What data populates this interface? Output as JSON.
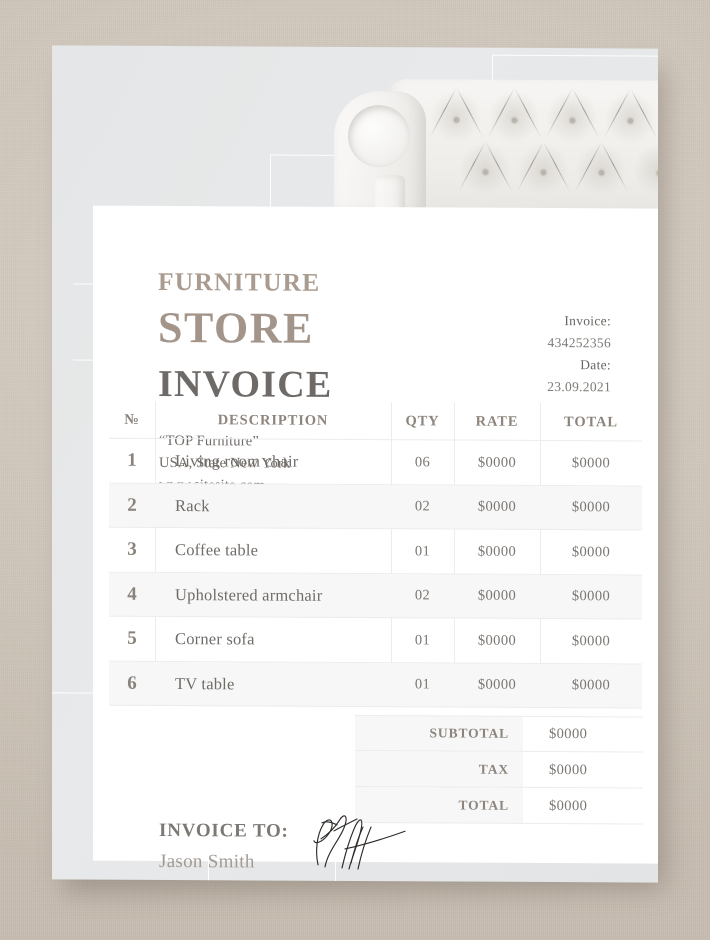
{
  "document": {
    "type": "invoice-template",
    "brand": {
      "line1": "FURNITURE",
      "line2": "STORE",
      "line3": "INVOICE"
    },
    "company": {
      "name": "“TOP Furniture”",
      "address": "USA, State New York",
      "website": "www.sitesite.com"
    },
    "meta": {
      "invoice_label": "Invoice:",
      "invoice_number": "434252356",
      "date_label": "Date:",
      "date_value": "23.09.2021"
    },
    "table": {
      "headers": {
        "no": "№",
        "description": "DESCRIPTION",
        "qty": "QTY",
        "rate": "RATE",
        "total": "TOTAL"
      },
      "rows": [
        {
          "no": "1",
          "description": "Living room chair",
          "qty": "06",
          "rate": "$0000",
          "total": "$0000"
        },
        {
          "no": "2",
          "description": "Rack",
          "qty": "02",
          "rate": "$0000",
          "total": "$0000"
        },
        {
          "no": "3",
          "description": "Coffee table",
          "qty": "01",
          "rate": "$0000",
          "total": "$0000"
        },
        {
          "no": "4",
          "description": "Upholstered armchair",
          "qty": "02",
          "rate": "$0000",
          "total": "$0000"
        },
        {
          "no": "5",
          "description": "Corner sofa",
          "qty": "01",
          "rate": "$0000",
          "total": "$0000"
        },
        {
          "no": "6",
          "description": "TV table",
          "qty": "01",
          "rate": "$0000",
          "total": "$0000"
        }
      ]
    },
    "totals": [
      {
        "label": "SUBTOTAL",
        "value": "$0000"
      },
      {
        "label": "TAX",
        "value": "$0000"
      },
      {
        "label": "TOTAL",
        "value": "$0000"
      }
    ],
    "recipient": {
      "title": "INVOICE TO:",
      "name": "Jason Smith",
      "signature": "handwritten-signature"
    },
    "imagery": {
      "hero": "white-tufted-chesterfield-sofa-photo"
    },
    "colors": {
      "backdrop": "#cfc6bb",
      "page": "#e5e7e8",
      "card": "#ffffff",
      "brand_taupe": "#a4958a",
      "heading_gray": "#6e6a67",
      "body_text": "#6f6b67",
      "table_header": "#8d857d",
      "row_stripe": "#f7f7f7",
      "rule": "#ececec",
      "name_taupe": "#a49a92"
    }
  }
}
